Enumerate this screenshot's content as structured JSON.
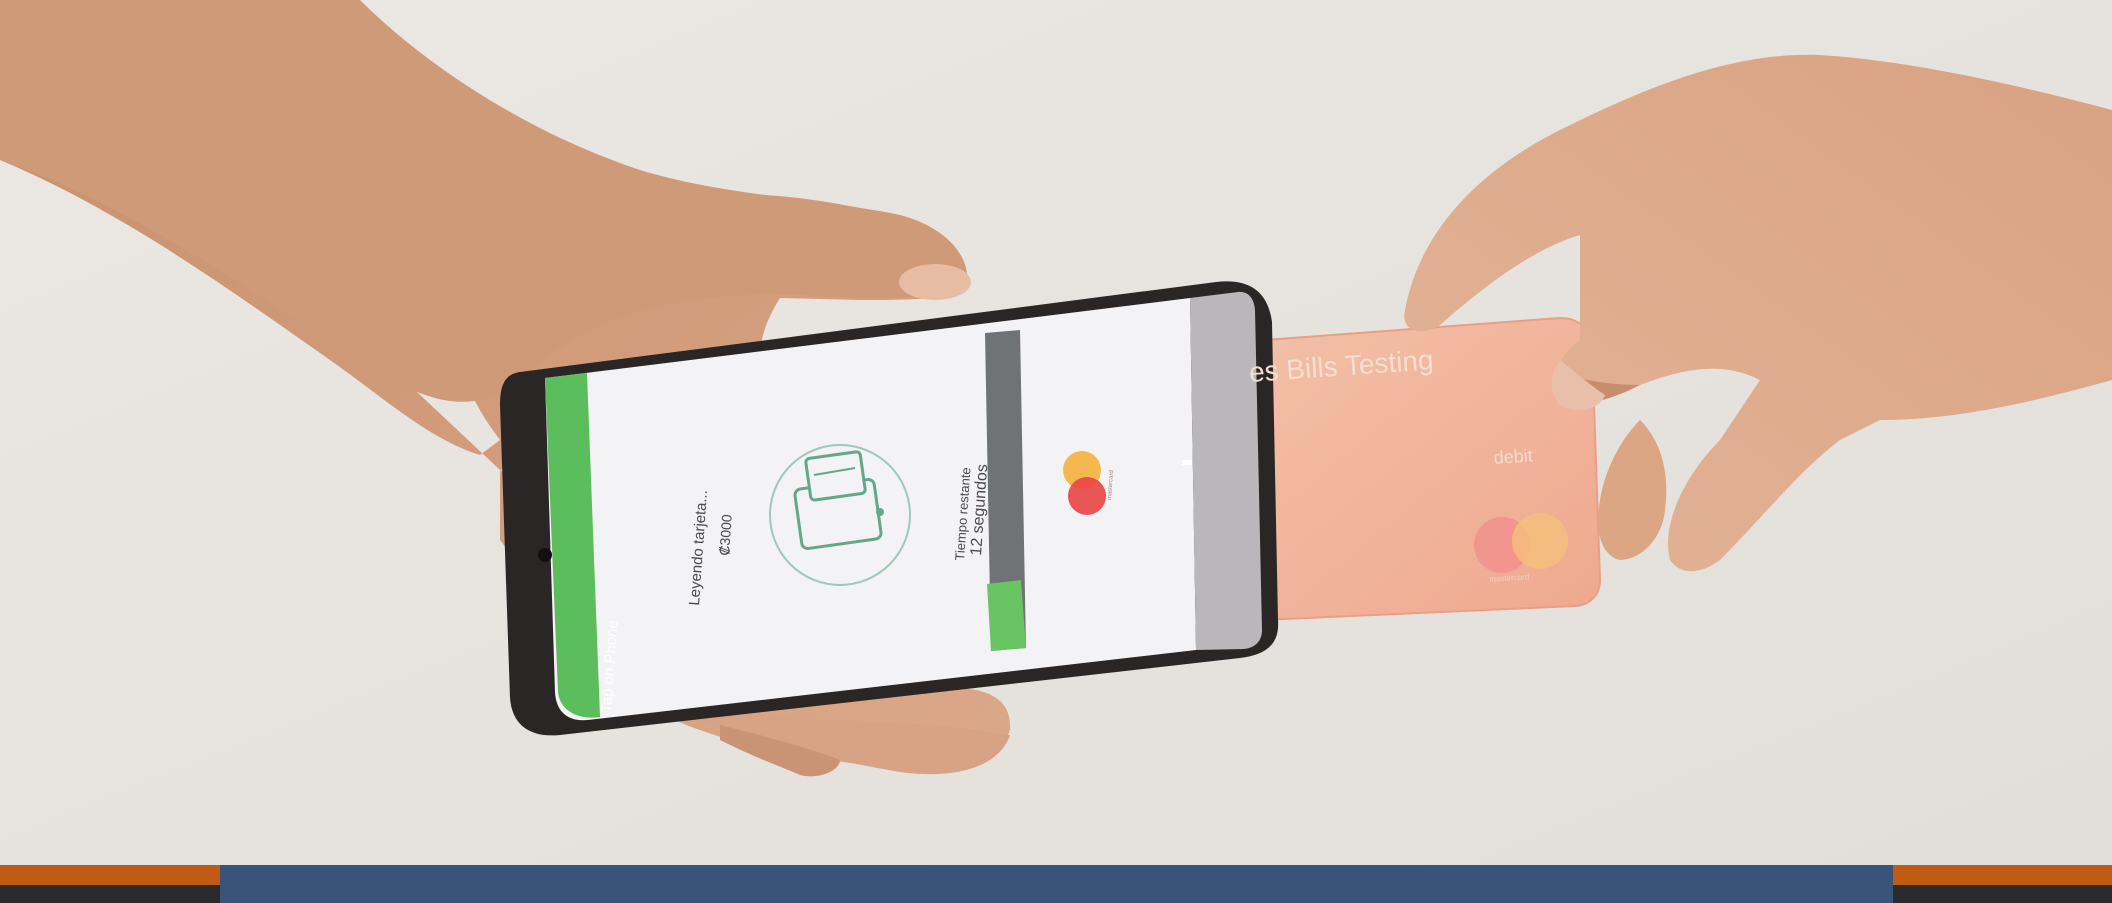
{
  "phone_screen": {
    "header_label": "Tap on Phone",
    "status_text": "Leyendo tarjeta...",
    "amount": "₡3000",
    "time_title": "Tiempo restante",
    "time_value": "12 segundos",
    "progress_fraction": 0.25,
    "brand_small_text": "mastercard",
    "colors": {
      "header": "#5cbd5c",
      "progress_empty": "#6f7375",
      "progress_fill": "#69c463"
    }
  },
  "card": {
    "name": "es Bills Testing",
    "type": "debit",
    "brand": "mastercard",
    "colors": {
      "body": "#efb09a",
      "mc_red": "#eb001b",
      "mc_yellow": "#f79e1b"
    }
  },
  "banner": {
    "colors": {
      "accent": "#c05b14",
      "dark": "#2b2b2b",
      "navy": "#3a5378"
    }
  },
  "icons": [
    "card-on-phone-icon",
    "mastercard-logo-icon"
  ]
}
